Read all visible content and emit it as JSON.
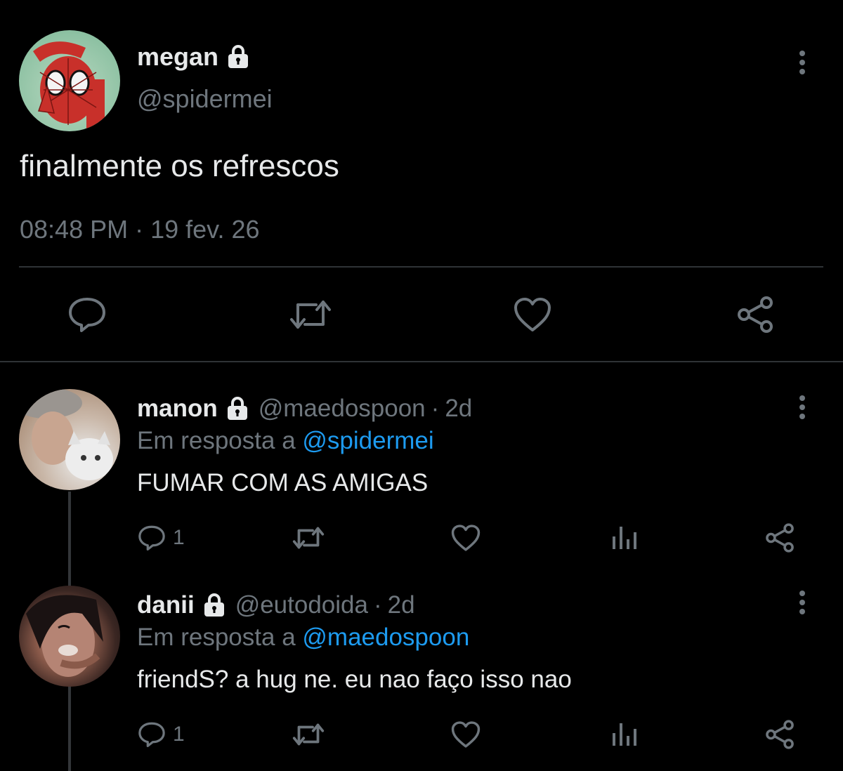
{
  "colors": {
    "background": "#000000",
    "primary_text": "#e7e9ea",
    "secondary_text": "#6e767d",
    "link": "#1d9bf0",
    "divider": "#2f3336"
  },
  "main_tweet": {
    "display_name": "megan",
    "handle": "@spidermei",
    "text": "finalmente os refrescos",
    "timestamp": "08:48 PM · 19 fev. 26",
    "icons": {
      "lock": "lock-icon",
      "more": "more-vertical-icon",
      "reply": "reply-icon",
      "retweet": "retweet-icon",
      "like": "heart-icon",
      "share": "share-icon"
    }
  },
  "replies": [
    {
      "display_name": "manon",
      "handle": "@maedospoon",
      "separator": "·",
      "time": "2d",
      "replying_prefix": "Em resposta a",
      "replying_to": "@spidermei",
      "text": "FUMAR COM AS AMIGAS",
      "reply_count": "1"
    },
    {
      "display_name": "danii",
      "handle": "@eutodoida",
      "separator": "·",
      "time": "2d",
      "replying_prefix": "Em resposta a",
      "replying_to": "@maedospoon",
      "text": "friendS? a hug ne. eu nao faço isso nao",
      "reply_count": "1"
    }
  ]
}
